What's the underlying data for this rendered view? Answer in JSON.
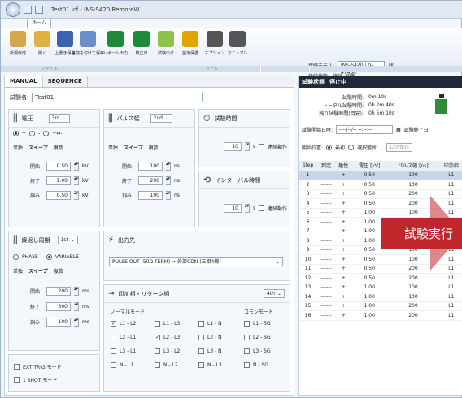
{
  "window": {
    "title": "Test01.icf - INS-S420 RemoteW",
    "tab_home": "ホーム"
  },
  "ribbon": {
    "buttons": [
      {
        "label": "新規作成",
        "icon": "new-file-icon",
        "color": "#d8a64a"
      },
      {
        "label": "開く",
        "icon": "open-folder-icon",
        "color": "#e0b040"
      },
      {
        "label": "上書き保存",
        "icon": "save-icon",
        "color": "#3a63b5"
      },
      {
        "label": "名前を付けて保存",
        "icon": "save-as-icon",
        "color": "#6a8fc8"
      },
      {
        "label": "レポート出力",
        "icon": "excel-icon",
        "color": "#1f8a3a"
      },
      {
        "label": "校正日",
        "icon": "calendar-icon",
        "color": "#1f8a3a"
      },
      {
        "label": "試験ログ",
        "icon": "log-icon",
        "color": "#8bc34a"
      },
      {
        "label": "設定保護",
        "icon": "lock-icon",
        "color": "#e0a400"
      },
      {
        "label": "オプション",
        "icon": "gear-icon",
        "color": "#555555"
      },
      {
        "label": "マニュアル",
        "icon": "manual-icon",
        "color": "#555555"
      }
    ],
    "groups": [
      "ファイル",
      "",
      "ツール",
      "",
      ""
    ],
    "model_label": "接続モデル:",
    "model_value": "INS-S420 / 0-4T450",
    "status_label": "接続状態:",
    "status_value": "接続",
    "disconnect_label": "切断"
  },
  "left": {
    "tabs": [
      "MANUAL",
      "SEQUENCE"
    ],
    "test_name_label": "試験名:",
    "test_name": "Test01",
    "voltage": {
      "title": "電圧",
      "mode": "3rd",
      "polarity": [
        "+",
        "-",
        "+⇔-"
      ],
      "sub_tabs": [
        "単独",
        "スイープ",
        "複数"
      ],
      "rows": [
        {
          "label": "開始",
          "value": "0.50",
          "unit": "kV"
        },
        {
          "label": "終了",
          "value": "1.00",
          "unit": "kV"
        },
        {
          "label": "刻み",
          "value": "0.50",
          "unit": "kV"
        }
      ]
    },
    "pulse": {
      "title": "パルス幅",
      "mode": "2nd",
      "sub_tabs": [
        "単独",
        "スイープ",
        "複数"
      ],
      "rows": [
        {
          "label": "開始",
          "value": "100",
          "unit": "ns"
        },
        {
          "label": "終了",
          "value": "200",
          "unit": "ns"
        },
        {
          "label": "刻み",
          "value": "100",
          "unit": "ns"
        }
      ]
    },
    "test_time": {
      "title": "試験時間",
      "value": "10",
      "unit": "s",
      "continuous": "連続動作"
    },
    "interval": {
      "title": "インターバル時間",
      "value": "10",
      "unit": "s",
      "continuous": "連続動作"
    },
    "period": {
      "title": "繰返し周期",
      "mode": "1st",
      "modes": [
        "PHASE",
        "VARIABLE"
      ],
      "sub_tabs": [
        "単独",
        "スイープ",
        "複数"
      ],
      "rows": [
        {
          "label": "開始",
          "value": "200",
          "unit": "ms"
        },
        {
          "label": "終了",
          "value": "300",
          "unit": "ms"
        },
        {
          "label": "刻み",
          "value": "100",
          "unit": "ms"
        }
      ]
    },
    "output": {
      "title": "出力先",
      "value": "PULSE OUT (50Ω TERM) ⇒ 外部CDN (三相4線)"
    },
    "coupling": {
      "title": "印加相・リターン相",
      "mode": "4th",
      "normal_label": "ノーマルモード",
      "common_label": "コモンモード",
      "normal": [
        [
          "L1 - L2",
          "L1 - L3",
          "L1 - N"
        ],
        [
          "L2 - L1",
          "L2 - L3",
          "L2 - N"
        ],
        [
          "L3 - L1",
          "L3 - L2",
          "L3 - N"
        ],
        [
          "N - L1",
          "N - L2",
          "N - L3"
        ]
      ],
      "common": [
        "L1 - SG",
        "L2 - SG",
        "L3 - SG",
        "N - SG"
      ]
    },
    "ext_trig": "EXT TRIG モード",
    "one_shot": "1 SHOT モード"
  },
  "right": {
    "state_label": "試験状態",
    "state_value": "停止中",
    "times": [
      {
        "label": "試験時間:",
        "value": "0m 10s"
      },
      {
        "label": "トータル試験時間:",
        "value": "0h 2m 40s"
      },
      {
        "label": "残り試験時間(目安):",
        "value": "0h 5m 10s"
      }
    ],
    "schedule_label": "試験開始日時:",
    "schedule_value": "----/--/-- --:--:--",
    "end_label": "試験終了日",
    "position_label": "開始位置:",
    "position_options": [
      "最初",
      "選択箇所"
    ],
    "log_button": "ログ保存",
    "columns": [
      "Step",
      "判定",
      "極性",
      "電圧 [kV]",
      "パルス幅 [ns]",
      "印加相"
    ],
    "rows": [
      [
        "1",
        "------",
        "+",
        "0.50",
        "100",
        "L1"
      ],
      [
        "2",
        "------",
        "+",
        "0.50",
        "100",
        "L1"
      ],
      [
        "3",
        "------",
        "+",
        "0.50",
        "200",
        "L1"
      ],
      [
        "4",
        "------",
        "+",
        "0.50",
        "200",
        "L1"
      ],
      [
        "5",
        "------",
        "+",
        "1.00",
        "100",
        "L1"
      ],
      [
        "6",
        "------",
        "+",
        "1.00",
        "100",
        "L1"
      ],
      [
        "7",
        "------",
        "+",
        "1.00",
        "200",
        "L1"
      ],
      [
        "8",
        "------",
        "+",
        "1.00",
        "200",
        "L1"
      ],
      [
        "9",
        "------",
        "+",
        "0.50",
        "100",
        "L1"
      ],
      [
        "10",
        "------",
        "+",
        "0.50",
        "100",
        "L1"
      ],
      [
        "11",
        "------",
        "+",
        "0.50",
        "200",
        "L1"
      ],
      [
        "12",
        "------",
        "+",
        "0.50",
        "200",
        "L1"
      ],
      [
        "13",
        "------",
        "+",
        "1.00",
        "100",
        "L1"
      ],
      [
        "14",
        "------",
        "+",
        "1.00",
        "100",
        "L1"
      ],
      [
        "15",
        "------",
        "+",
        "1.00",
        "200",
        "L1"
      ],
      [
        "16",
        "------",
        "+",
        "1.00",
        "200",
        "L1"
      ]
    ]
  },
  "banner": "試験実行",
  "colors": {
    "accent": "#c0272d",
    "state_bar": "#1f2a3a",
    "battery": "#2e8b3c"
  }
}
